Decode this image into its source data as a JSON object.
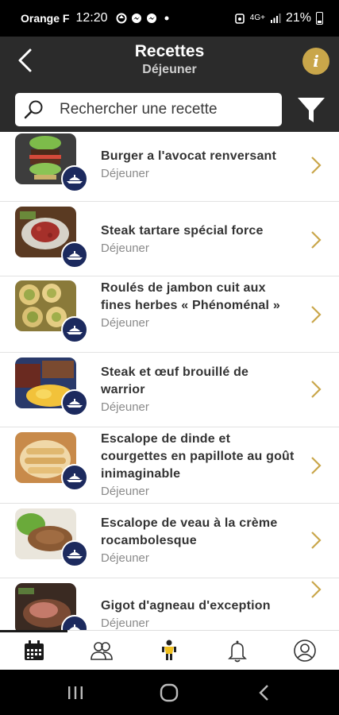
{
  "status_bar": {
    "carrier": "Orange F",
    "time": "12:20",
    "network": "4G+",
    "battery": "21%"
  },
  "header": {
    "title": "Recettes",
    "subtitle": "Déjeuner",
    "info_label": "i"
  },
  "search": {
    "placeholder": "Rechercher une recette"
  },
  "recipes": [
    {
      "title": "Burger a l'avocat renversant",
      "category": "Déjeuner",
      "image": "avocado-burger"
    },
    {
      "title": "Steak tartare spécial force",
      "category": "Déjeuner",
      "image": "steak-tartare"
    },
    {
      "title": "Roulés de jambon cuit aux fines herbes « Phénoménal »",
      "category": "Déjeuner",
      "image": "ham-rolls"
    },
    {
      "title": "Steak et œuf brouillé de warrior",
      "category": "Déjeuner",
      "image": "steak-eggs"
    },
    {
      "title": "Escalope de dinde et courgettes en papillote au goût inimaginable",
      "category": "Déjeuner",
      "image": "turkey-zucchini"
    },
    {
      "title": "Escalope de veau à la crème rocambolesque",
      "category": "Déjeuner",
      "image": "veal-cream"
    },
    {
      "title": "Gigot d'agneau d'exception",
      "category": "Déjeuner",
      "image": "lamb-leg"
    }
  ],
  "bottom_nav": {
    "items": [
      "calendar-icon",
      "community-icon",
      "athlete-icon",
      "bell-icon",
      "profile-icon"
    ],
    "active": "calendar-icon"
  },
  "colors": {
    "header_bg": "#2b2b2b",
    "accent_gold": "#c9a64a",
    "badge_navy": "#1c2a5e"
  }
}
